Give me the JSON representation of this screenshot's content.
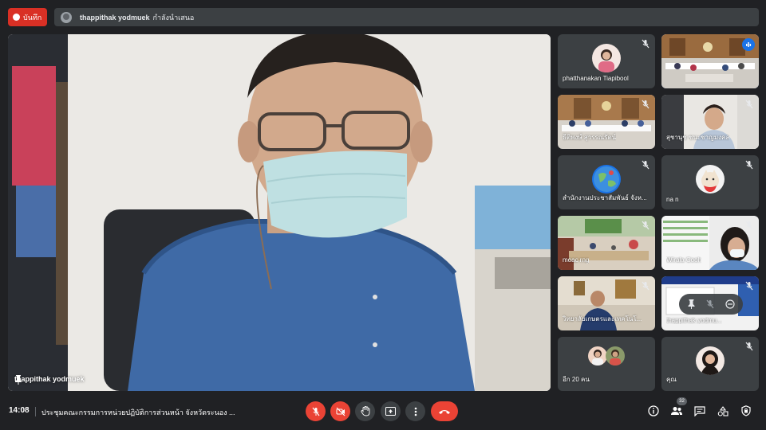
{
  "topbar": {
    "record_label": "บันทึก",
    "presenter_name": "thappithak yodmuek",
    "presenting_text": "กำลังนำเสนอ"
  },
  "main": {
    "participant_name": "thappithak yodmuek"
  },
  "tiles": [
    {
      "name": "phatthanakan Tiapibool"
    },
    {
      "name": ""
    },
    {
      "name": "ธีติพงษ์ สุวรรณรัตน์"
    },
    {
      "name": "สุชานุช ชนะชาญมงคล"
    },
    {
      "name": "สำนักงานประชาสัมพันธ์ จังห..."
    },
    {
      "name": "na n"
    },
    {
      "name": "moac rng"
    },
    {
      "name": "Wirala Cooh"
    },
    {
      "name": "วิทยาลัยเกษตรและเทคโนโ..."
    },
    {
      "name": "thappithak yodmu..."
    },
    {
      "name": "อีก 20 คน"
    },
    {
      "name": "คุณ"
    }
  ],
  "bottom": {
    "time": "14:08",
    "meeting_title": "ประชุมคณะกรรมการหน่วยปฏิบัติการส่วนหน้า จังหวัดระนอง ...",
    "participant_count": "32"
  },
  "colors": {
    "background": "#202124",
    "surface": "#3c4043",
    "red": "#ea4335",
    "accent_blue": "#8ab4f8"
  }
}
